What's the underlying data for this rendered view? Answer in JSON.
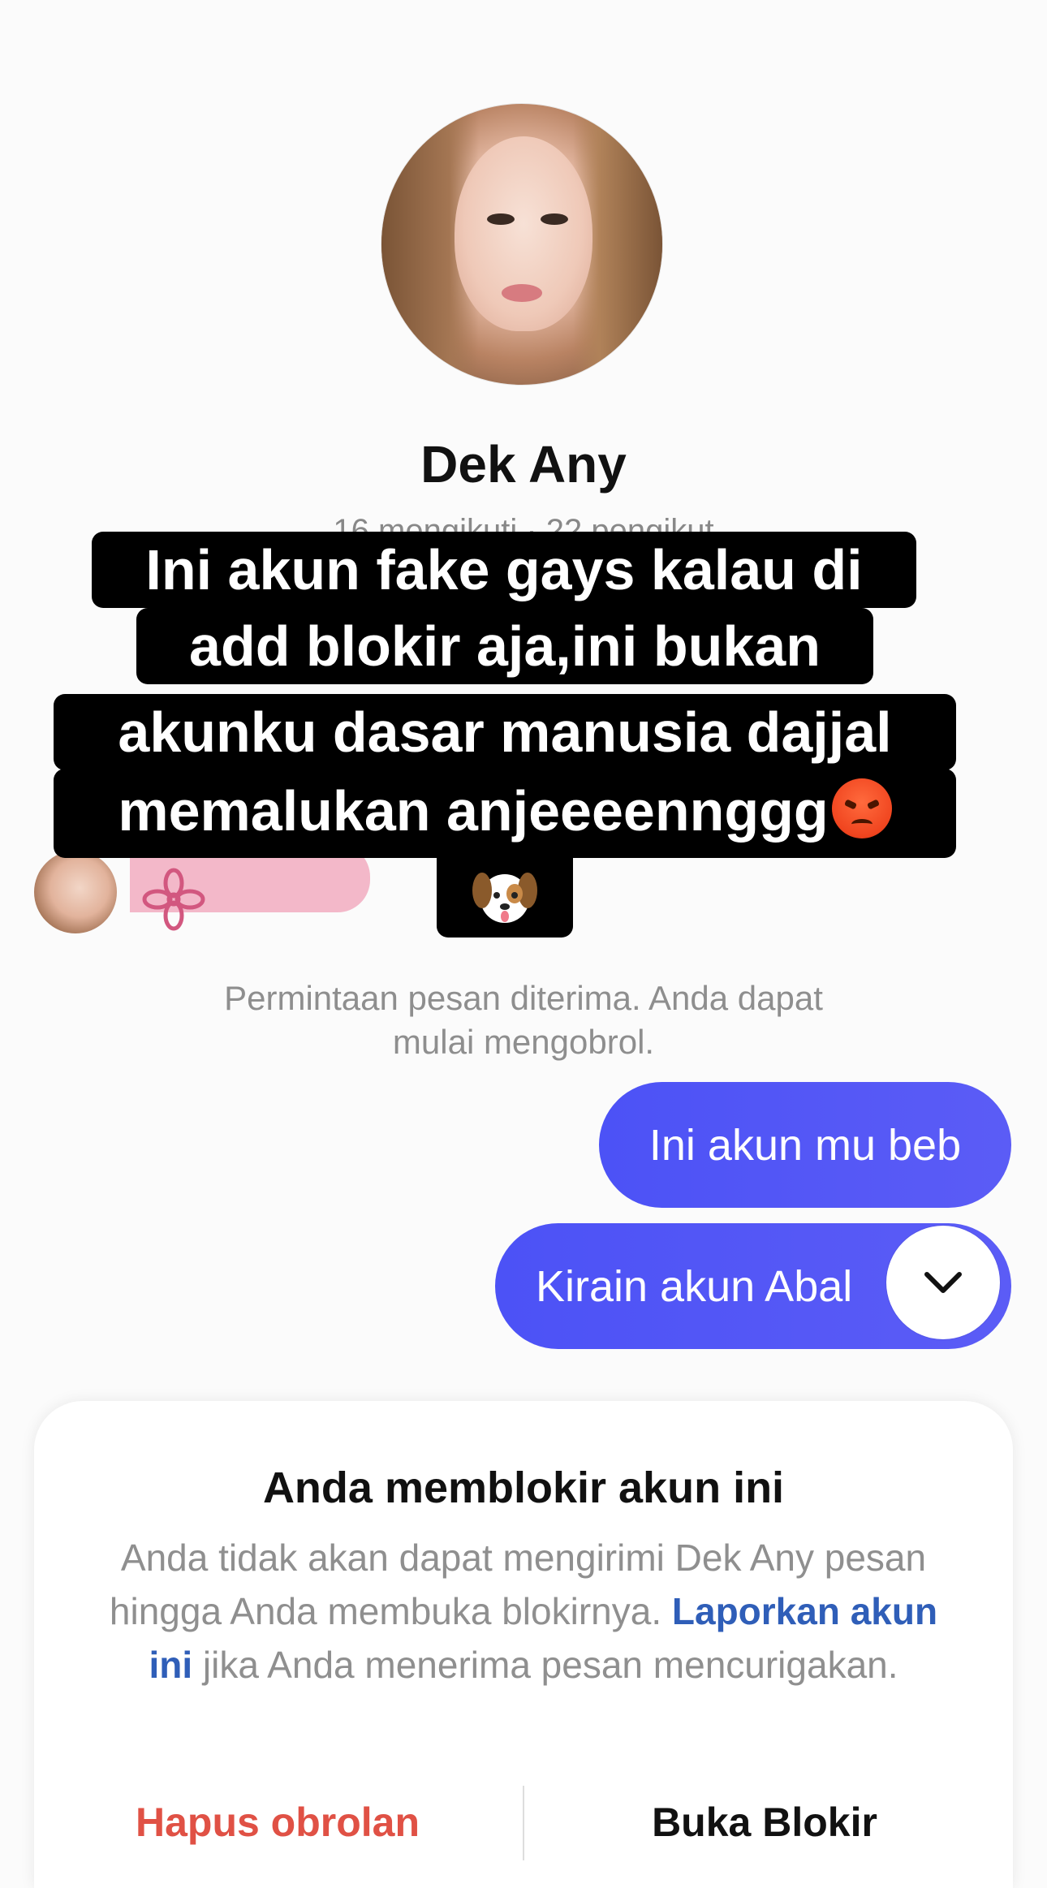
{
  "profile": {
    "name": "Dek Any",
    "stats": "16 mengikuti · 22 pengikut"
  },
  "caption": {
    "line1": "Ini akun fake gays kalau di",
    "line2": "add blokir aja,ini bukan",
    "line3": "akunku dasar manusia dajjal",
    "line4": "memalukan anjeeeennggg",
    "emoji_angry": "angry-face-emoji",
    "emoji_dog": "dog-face-emoji"
  },
  "chat": {
    "info_line1": "Permintaan pesan diterima. Anda dapat",
    "info_line2": "mulai mengobrol.",
    "messages": [
      {
        "from": "me",
        "text": "Ini akun mu beb"
      },
      {
        "from": "me",
        "text": "Kirain akun Abal"
      }
    ],
    "accent": "#4c52f6"
  },
  "blocked": {
    "title": "Anda memblokir akun ini",
    "desc_part1": "Anda tidak akan dapat mengirimi Dek Any pesan hingga Anda membuka blokirnya.",
    "report_link": "Laporkan akun ini",
    "desc_part2": "jika Anda menerima pesan mencurigakan.",
    "delete_label": "Hapus obrolan",
    "unblock_label": "Buka Blokir",
    "delete_color": "#e05145",
    "link_color": "#2f5eb8"
  }
}
